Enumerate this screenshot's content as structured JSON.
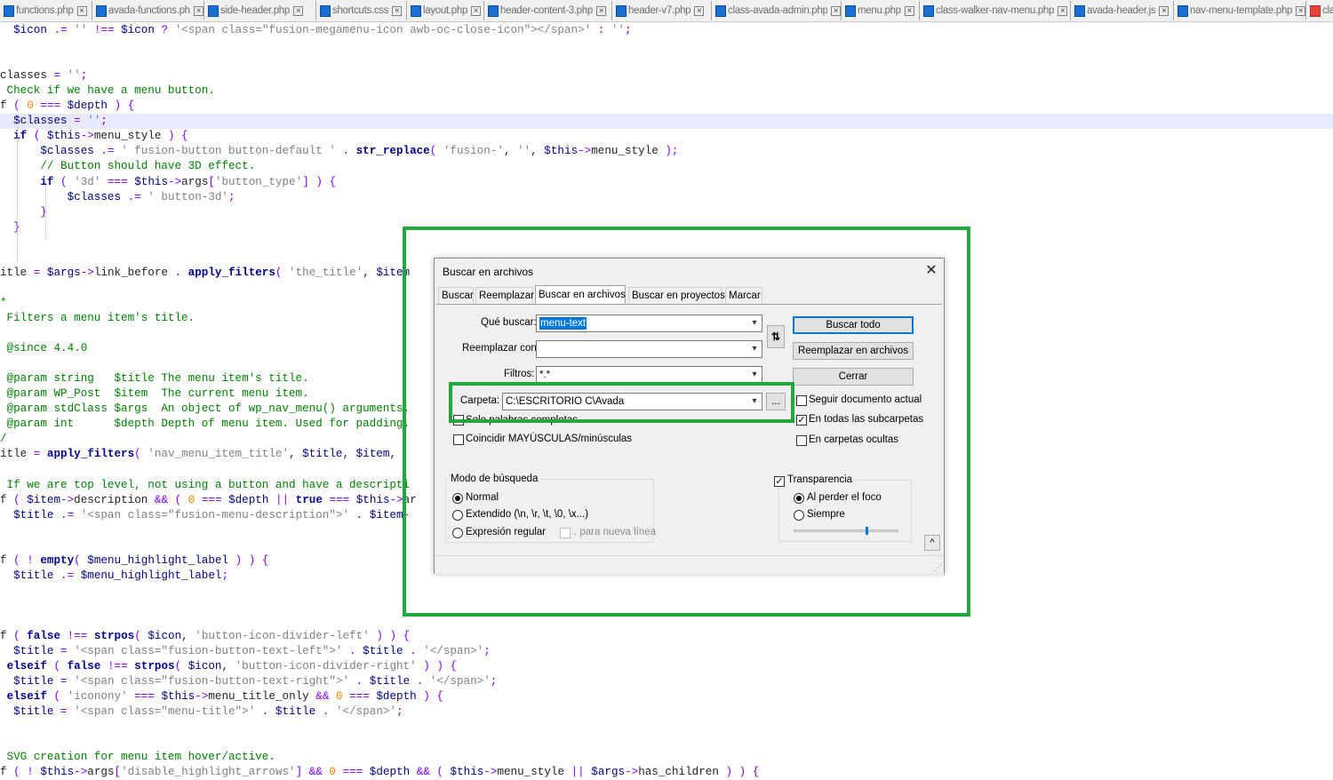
{
  "tabs": [
    {
      "label": "functions.php",
      "icon": "file-php-icon"
    },
    {
      "label": "avada-functions.php",
      "icon": "file-php-icon"
    },
    {
      "label": "side-header.php",
      "icon": "file-php-icon"
    },
    {
      "label": "shortcuts.css",
      "icon": "file-css-icon"
    },
    {
      "label": "layout.php",
      "icon": "file-php-icon"
    },
    {
      "label": "header-content-3.php",
      "icon": "file-php-icon"
    },
    {
      "label": "header-v7.php",
      "icon": "file-php-icon"
    },
    {
      "label": "class-avada-admin.php",
      "icon": "file-php-icon"
    },
    {
      "label": "menu.php",
      "icon": "file-php-icon"
    },
    {
      "label": "class-walker-nav-menu.php",
      "icon": "file-php-icon"
    },
    {
      "label": "avada-header.js",
      "icon": "file-js-icon"
    },
    {
      "label": "nav-menu-template.php",
      "icon": "file-php-icon"
    },
    {
      "label": "cla",
      "icon": "file-php-modified-icon"
    }
  ],
  "code_lines": [
    "  $icon .= '' !== $icon ? '<span class=\"fusion-megamenu-icon awb-oc-close-icon\"></span>' : '';",
    "",
    "",
    "classes = '';",
    " Check if we have a menu button.",
    "f ( 0 === $depth ) {",
    "  $classes = '';",
    "  if ( $this->menu_style ) {",
    "      $classes .= ' fusion-button button-default ' . str_replace( 'fusion-', '', $this->menu_style );",
    "      // Button should have 3D effect.",
    "      if ( '3d' === $this->args['button_type'] ) {",
    "          $classes .= ' button-3d';",
    "      }",
    "  }",
    "",
    "",
    "itle = $args->link_before . apply_filters( 'the_title', $item",
    "",
    "*",
    " Filters a menu item's title.",
    "",
    " @since 4.4.0",
    "",
    " @param string   $title The menu item's title.",
    " @param WP_Post  $item  The current menu item.",
    " @param stdClass $args  An object of wp_nav_menu() arguments.",
    " @param int      $depth Depth of menu item. Used for padding.",
    "/",
    "itle = apply_filters( 'nav_menu_item_title', $title, $item,",
    "",
    " If we are top level, not using a button and have a descripti",
    "f ( $item->description && ( 0 === $depth || true === $this->ar",
    "  $title .= '<span class=\"fusion-menu-description\">' . $item-",
    "",
    "",
    "f ( ! empty( $menu_highlight_label ) ) {",
    "  $title .= $menu_highlight_label;",
    "",
    "",
    "",
    "f ( false !== strpos( $icon, 'button-icon-divider-left' ) ) {",
    "  $title = '<span class=\"fusion-button-text-left\">' . $title . '</span>';",
    " elseif ( false !== strpos( $icon, 'button-icon-divider-right' ) ) {",
    "  $title = '<span class=\"fusion-button-text-right\">' . $title . '</span>';",
    " elseif ( 'iconony' === $this->menu_title_only && 0 === $depth ) {",
    "  $title = '<span class=\"menu-title\">' . $title . '</span>';",
    "",
    "",
    " SVG creation for menu item hover/active.",
    "f ( ! $this->args['disable_highlight_arrows'] && 0 === $depth && ( $this->menu_style || $args->has_children ) ) {"
  ],
  "dialog": {
    "title": "Buscar en archivos",
    "close_icon": "close-icon",
    "tabs": [
      "Buscar",
      "Reemplazar",
      "Buscar en archivos",
      "Buscar en proyectos",
      "Marcar"
    ],
    "active_tab": "Buscar en archivos",
    "find_label": "Qué buscar:",
    "find_value": "menu-text",
    "replace_label": "Reemplazar con:",
    "replace_value": "",
    "filters_label": "Filtros:",
    "filters_value": "*.*",
    "folder_label": "Carpeta:",
    "folder_value": "C:\\ESCRITORIO C\\Avada",
    "browse_label": "...",
    "swap_icon": "swap-arrows-icon",
    "buttons": {
      "find_all": "Buscar todo",
      "replace_in_files": "Reemplazar en archivos",
      "close": "Cerrar"
    },
    "options_right": {
      "follow_doc": {
        "label": "Seguir documento actual",
        "checked": false
      },
      "subfolders": {
        "label": "En todas las subcarpetas",
        "checked": true
      },
      "hidden_folders": {
        "label": "En carpetas ocultas",
        "checked": false
      }
    },
    "options_left": {
      "whole_word": {
        "label": "Solo palabras completas",
        "checked": false
      },
      "match_case": {
        "label": "Coincidir MAYÚSCULAS/minúsculas",
        "checked": false
      }
    },
    "search_mode": {
      "title": "Modo de búsqueda",
      "normal": "Normal",
      "extended": "Extendido (\\n, \\r, \\t, \\0, \\x...)",
      "regex": "Expresión regular",
      "dot_newline": ". para nueva línea",
      "selected": "Normal"
    },
    "transparency": {
      "label": "Transparencia",
      "checked": true,
      "on_lose_focus": "Al perder el foco",
      "always": "Siempre",
      "selected": "Al perder el foco",
      "level": 0.7
    },
    "collapse_icon": "chevron-up-icon"
  },
  "colors": {
    "highlight_box": "#1fa83e",
    "selection": "#0078d7",
    "keyword": "#00008b",
    "string": "#808080",
    "number": "#ff8000",
    "comment": "#008000"
  }
}
